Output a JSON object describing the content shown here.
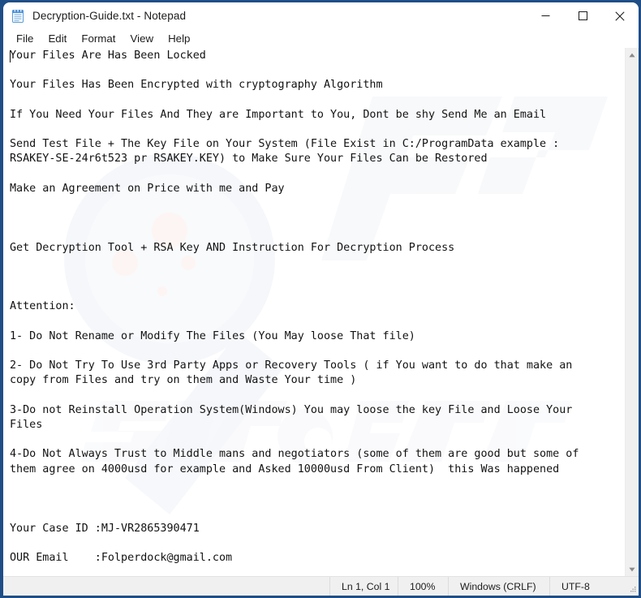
{
  "window": {
    "title": "Decryption-Guide.txt - Notepad",
    "icon": "notepad-icon",
    "border_color": "#1f4e87",
    "controls": [
      {
        "name": "minimize",
        "glyph": "minimize-icon"
      },
      {
        "name": "maximize",
        "glyph": "maximize-icon"
      },
      {
        "name": "close",
        "glyph": "close-icon"
      }
    ]
  },
  "menubar": {
    "items": [
      {
        "label": "File"
      },
      {
        "label": "Edit"
      },
      {
        "label": "Format"
      },
      {
        "label": "View"
      },
      {
        "label": "Help"
      }
    ]
  },
  "document": {
    "filename": "Decryption-Guide.txt",
    "content": "Your Files Are Has Been Locked\n\nYour Files Has Been Encrypted with cryptography Algorithm\n\nIf You Need Your Files And They are Important to You, Dont be shy Send Me an Email\n\nSend Test File + The Key File on Your System (File Exist in C:/ProgramData example :\nRSAKEY-SE-24r6t523 pr RSAKEY.KEY) to Make Sure Your Files Can be Restored\n\nMake an Agreement on Price with me and Pay\n\n\n\nGet Decryption Tool + RSA Key AND Instruction For Decryption Process\n\n\n\nAttention:\n\n1- Do Not Rename or Modify The Files (You May loose That file)\n\n2- Do Not Try To Use 3rd Party Apps or Recovery Tools ( if You want to do that make an\ncopy from Files and try on them and Waste Your time )\n\n3-Do not Reinstall Operation System(Windows) You may loose the key File and Loose Your\nFiles\n\n4-Do Not Always Trust to Middle mans and negotiators (some of them are good but some of\nthem agree on 4000usd for example and Asked 10000usd From Client)  this Was happened\n\n\n\nYour Case ID :MJ-VR2865390471\n\nOUR Email    :Folperdock@gmail.com",
    "case_id": "MJ-VR2865390471",
    "email": "Folperdock@gmail.com"
  },
  "scrollbar": {
    "up_arrow": "scroll-up-icon",
    "down_arrow": "scroll-down-icon"
  },
  "statusbar": {
    "position": "Ln 1, Col 1",
    "zoom": "100%",
    "line_endings": "Windows (CRLF)",
    "encoding": "UTF-8"
  }
}
